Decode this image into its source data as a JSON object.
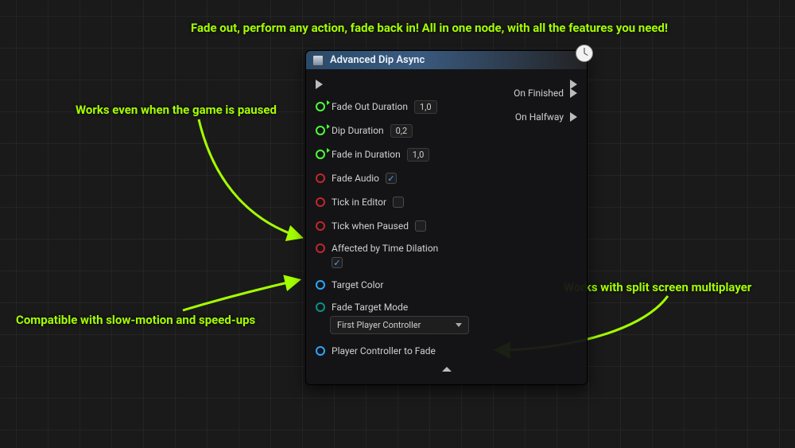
{
  "annotations": {
    "tagline": "Fade out, perform any action, fade back in! All in one node, with all the features you need!",
    "paused": "Works even when the game is paused",
    "timedilation": "Compatible with slow-motion and speed-ups",
    "splitscreen": "Works with split screen multiplayer"
  },
  "node": {
    "title": "Advanced Dip Async",
    "inputs": {
      "fade_out_duration": {
        "label": "Fade Out Duration",
        "value": "1,0"
      },
      "dip_duration": {
        "label": "Dip Duration",
        "value": "0,2"
      },
      "fade_in_duration": {
        "label": "Fade in Duration",
        "value": "1,0"
      },
      "fade_audio": {
        "label": "Fade Audio",
        "checked": true
      },
      "tick_in_editor": {
        "label": "Tick in Editor",
        "checked": false
      },
      "tick_when_paused": {
        "label": "Tick when Paused",
        "checked": false
      },
      "affected_by_time_dilation": {
        "label": "Affected by Time Dilation",
        "checked": true
      },
      "target_color": {
        "label": "Target Color"
      },
      "fade_target_mode": {
        "label": "Fade Target Mode",
        "selected": "First Player Controller"
      },
      "player_controller_to_fade": {
        "label": "Player Controller to Fade"
      }
    },
    "outputs": {
      "on_finished": "On Finished",
      "on_halfway": "On Halfway"
    }
  },
  "colors": {
    "accent": "#a4ff00"
  }
}
